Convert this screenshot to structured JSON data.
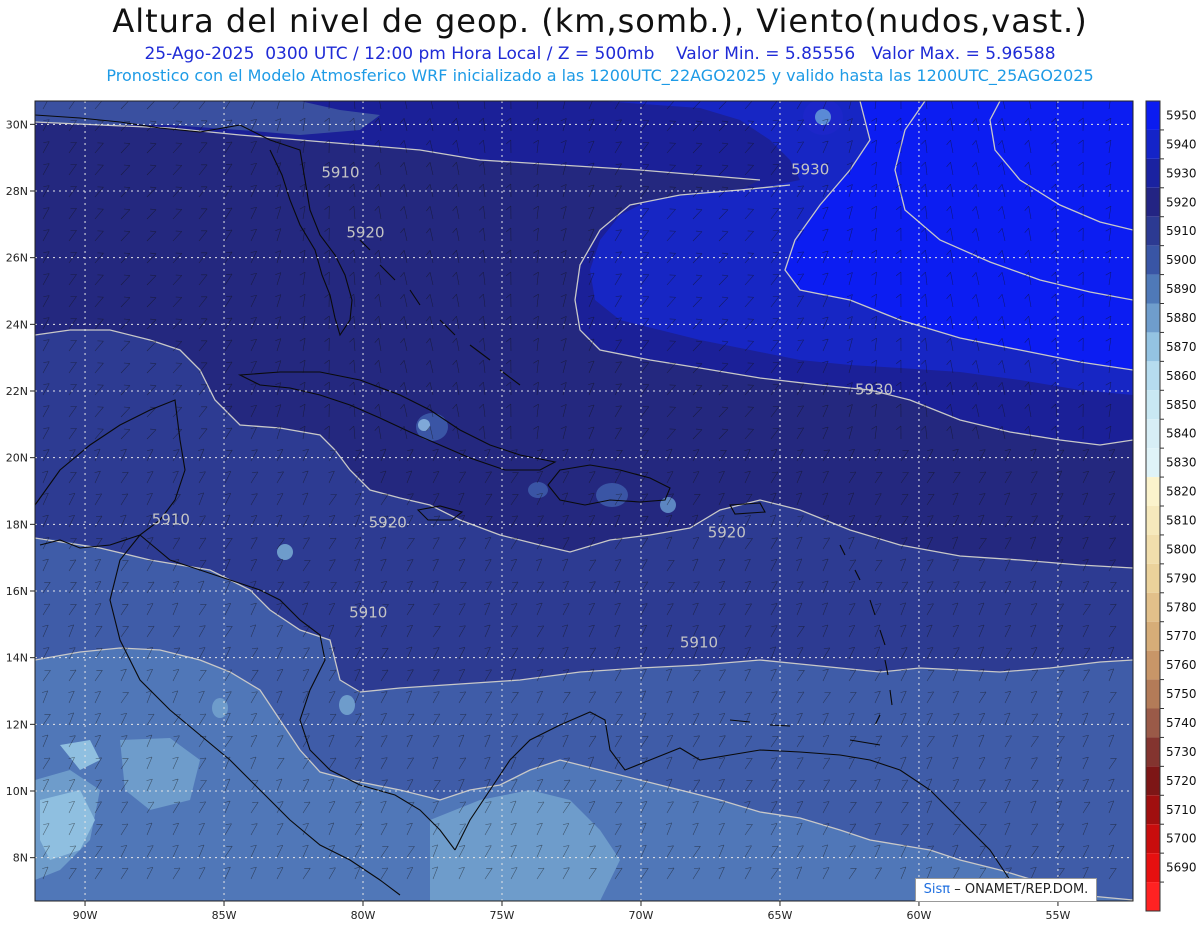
{
  "header": {
    "title": "Altura del nivel de geop. (km,somb.), Viento(nudos,vast.)",
    "date": "25-Ago-2025",
    "time": "0300 UTC / 12:00 pm Hora Local / Z = 500mb",
    "vmin": "Valor Min. = 5.85556",
    "vmax": "Valor Max. = 5.96588",
    "forecast": "Pronostico con el Modelo Atmosferico WRF inicializado a las 1200UTC_22AGO2025 y valido hasta las 1200UTC_25AGO2025"
  },
  "map": {
    "lat_ticks": [
      "30N",
      "28N",
      "26N",
      "24N",
      "22N",
      "20N",
      "18N",
      "16N",
      "14N",
      "12N",
      "10N",
      "8N"
    ],
    "lon_ticks": [
      "90W",
      "85W",
      "80W",
      "75W",
      "70W",
      "65W",
      "60W",
      "55W"
    ],
    "contour_labels": [
      {
        "text": "5910",
        "lon": -81.5,
        "lat": 28.4
      },
      {
        "text": "5920",
        "lon": -80.6,
        "lat": 26.6
      },
      {
        "text": "5930",
        "lon": -64.6,
        "lat": 28.5
      },
      {
        "text": "5930",
        "lon": -62.3,
        "lat": 21.9
      },
      {
        "text": "5910",
        "lon": -87.6,
        "lat": 18.0
      },
      {
        "text": "5920",
        "lon": -79.8,
        "lat": 17.9
      },
      {
        "text": "5920",
        "lon": -67.6,
        "lat": 17.6
      },
      {
        "text": "5910",
        "lon": -80.5,
        "lat": 15.2
      },
      {
        "text": "5910",
        "lon": -68.6,
        "lat": 14.3
      }
    ]
  },
  "colorbar": {
    "levels": [
      "5950",
      "5940",
      "5930",
      "5920",
      "5910",
      "5900",
      "5890",
      "5880",
      "5870",
      "5860",
      "5850",
      "5840",
      "5830",
      "5820",
      "5810",
      "5800",
      "5790",
      "5780",
      "5770",
      "5760",
      "5750",
      "5740",
      "5730",
      "5720",
      "5710",
      "5700",
      "5690"
    ],
    "colors": [
      "#0b1cf0",
      "#1424c8",
      "#1a22a0",
      "#232483",
      "#2c3a92",
      "#3955a5",
      "#4f79b8",
      "#6f9dcc",
      "#94c3e2",
      "#b6dcef",
      "#c9e8f3",
      "#d7eef6",
      "#dff3f8",
      "#fbf3cc",
      "#f6e9bc",
      "#f1deac",
      "#ebd29b",
      "#e2c08a",
      "#d6ad78",
      "#c89668",
      "#b37b58",
      "#9a5a48",
      "#83342f",
      "#7d1616",
      "#a00f0f",
      "#c80d0d",
      "#e61010",
      "#ff2222"
    ]
  },
  "credit": {
    "brand": "Sisπ",
    "org": "– ONAMET/REP.DOM."
  }
}
